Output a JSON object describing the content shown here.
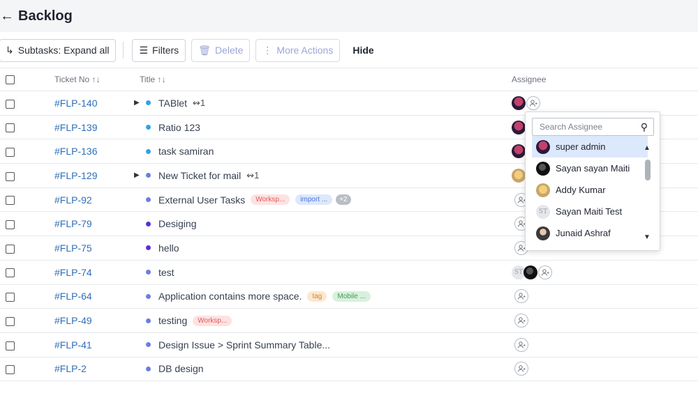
{
  "header": {
    "back_icon": "arrow-left-icon",
    "title": "Backlog"
  },
  "toolbar": {
    "subtasks_label": "Subtasks: Expand all",
    "filters_label": "Filters",
    "delete_label": "Delete",
    "more_actions_label": "More Actions",
    "hide_label": "Hide"
  },
  "table": {
    "headers": {
      "ticket_no": "Ticket No ↑↓",
      "title": "Title ↑↓",
      "assignee": "Assignee"
    },
    "rows": [
      {
        "ticket": "#FLP-140",
        "title": "TABlet",
        "expand": true,
        "subtasks": "1",
        "dot": "#2ea3e6",
        "tags": [],
        "assignees": [
          "sa"
        ]
      },
      {
        "ticket": "#FLP-139",
        "title": "Ratio 123",
        "expand": false,
        "subtasks": "",
        "dot": "#2ea3e6",
        "tags": [],
        "assignees": [
          "sa"
        ]
      },
      {
        "ticket": "#FLP-136",
        "title": "task samiran",
        "expand": false,
        "subtasks": "",
        "dot": "#2ea3e6",
        "tags": [],
        "assignees": [
          "sa"
        ]
      },
      {
        "ticket": "#FLP-129",
        "title": "New Ticket for mail",
        "expand": true,
        "subtasks": "1",
        "dot": "#6b7fe0",
        "tags": [],
        "assignees": [
          "addy"
        ]
      },
      {
        "ticket": "#FLP-92",
        "title": "External User Tasks",
        "expand": false,
        "subtasks": "",
        "dot": "#6b7fe0",
        "tags": [
          {
            "text": "Worksp...",
            "color": "red"
          },
          {
            "text": "import ...",
            "color": "blue"
          },
          {
            "text": "+2",
            "color": "gray"
          }
        ],
        "assignees": []
      },
      {
        "ticket": "#FLP-79",
        "title": "Desiging",
        "expand": false,
        "subtasks": "",
        "dot": "#5b2fd6",
        "tags": [],
        "assignees": []
      },
      {
        "ticket": "#FLP-75",
        "title": "hello",
        "expand": false,
        "subtasks": "",
        "dot": "#5b2fd6",
        "tags": [],
        "assignees": []
      },
      {
        "ticket": "#FLP-74",
        "title": "test",
        "expand": false,
        "subtasks": "",
        "dot": "#6b7fe0",
        "tags": [],
        "assignees": [
          "st",
          "dark"
        ]
      },
      {
        "ticket": "#FLP-64",
        "title": "Application contains more space.",
        "expand": false,
        "subtasks": "",
        "dot": "#6b7fe0",
        "tags": [
          {
            "text": "tag",
            "color": "orange"
          },
          {
            "text": "Mobile ...",
            "color": "green"
          }
        ],
        "assignees": []
      },
      {
        "ticket": "#FLP-49",
        "title": "testing",
        "expand": false,
        "subtasks": "",
        "dot": "#6b7fe0",
        "tags": [
          {
            "text": "Worksp...",
            "color": "red"
          }
        ],
        "assignees": []
      },
      {
        "ticket": "#FLP-41",
        "title": "Design Issue > Sprint Summary Table...",
        "expand": false,
        "subtasks": "",
        "dot": "#6b7fe0",
        "tags": [],
        "assignees": []
      },
      {
        "ticket": "#FLP-2",
        "title": "DB design",
        "expand": false,
        "subtasks": "",
        "dot": "#6b7fe0",
        "tags": [],
        "assignees": []
      }
    ]
  },
  "assignee_dropdown": {
    "search_placeholder": "Search Assignee",
    "items": [
      {
        "name": "super admin",
        "avatar": "sa",
        "selected": true
      },
      {
        "name": "Sayan sayan Maiti",
        "avatar": "dark",
        "selected": false
      },
      {
        "name": "Addy Kumar",
        "avatar": "addy",
        "selected": false
      },
      {
        "name": "Sayan Maiti Test",
        "avatar": "st",
        "initials": "ST",
        "selected": false
      },
      {
        "name": "Junaid Ashraf",
        "avatar": "ja",
        "selected": false
      }
    ]
  },
  "colors": {
    "link": "#2f6fb8",
    "selected_row": "#dce8fb",
    "header_bg": "#f4f5f7"
  }
}
